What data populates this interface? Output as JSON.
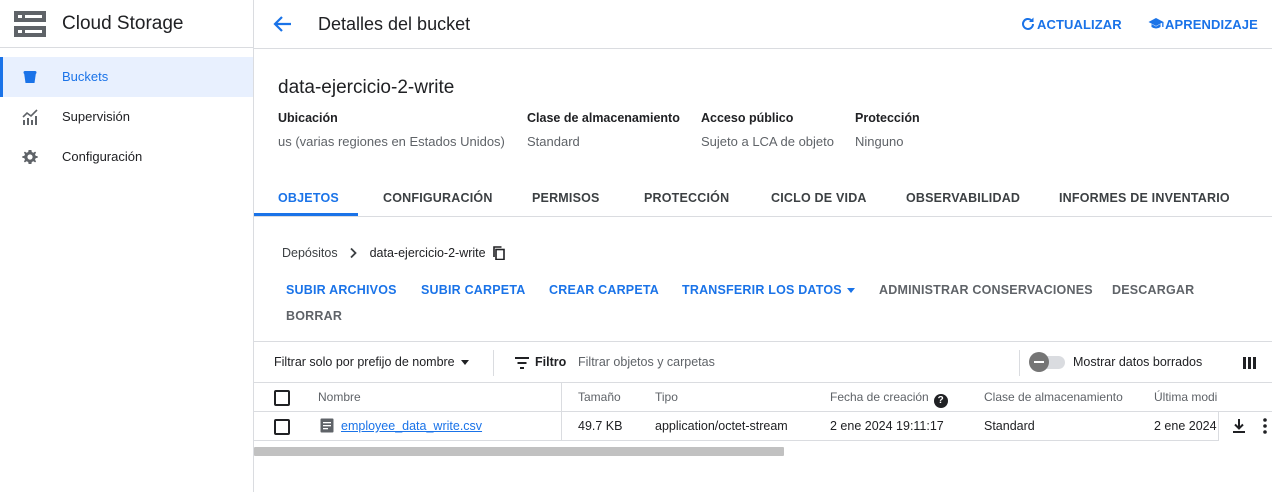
{
  "sidebar": {
    "product_title": "Cloud Storage",
    "items": [
      {
        "label": "Buckets",
        "icon": "bucket-icon",
        "active": true
      },
      {
        "label": "Supervisión",
        "icon": "monitoring-chart-icon",
        "active": false
      },
      {
        "label": "Configuración",
        "icon": "gear-icon",
        "active": false
      }
    ]
  },
  "header": {
    "title": "Detalles del bucket",
    "refresh_label": "ACTUALIZAR",
    "learn_label": "APRENDIZAJE"
  },
  "bucket": {
    "name": "data-ejercicio-2-write",
    "info": [
      {
        "label": "Ubicación",
        "value": "us (varias regiones en Estados Unidos)"
      },
      {
        "label": "Clase de almacenamiento",
        "value": "Standard"
      },
      {
        "label": "Acceso público",
        "value": "Sujeto a LCA de objeto"
      },
      {
        "label": "Protección",
        "value": "Ninguno"
      }
    ]
  },
  "tabs": [
    {
      "label": "OBJETOS",
      "active": true
    },
    {
      "label": "CONFIGURACIÓN",
      "active": false
    },
    {
      "label": "PERMISOS",
      "active": false
    },
    {
      "label": "PROTECCIÓN",
      "active": false
    },
    {
      "label": "CICLO DE VIDA",
      "active": false
    },
    {
      "label": "OBSERVABILIDAD",
      "active": false
    },
    {
      "label": "INFORMES DE INVENTARIO",
      "active": false
    }
  ],
  "breadcrumb": {
    "root": "Depósitos",
    "current": "data-ejercicio-2-write"
  },
  "actions": {
    "upload_files": "SUBIR ARCHIVOS",
    "upload_folder": "SUBIR CARPETA",
    "create_folder": "CREAR CARPETA",
    "transfer_data": "TRANSFERIR LOS DATOS",
    "manage_holds": "ADMINISTRAR CONSERVACIONES",
    "download": "DESCARGAR",
    "delete": "BORRAR"
  },
  "filter": {
    "prefix_select": "Filtrar solo por prefijo de nombre",
    "filter_label": "Filtro",
    "placeholder": "Filtrar objetos y carpetas",
    "show_deleted_label": "Mostrar datos borrados",
    "show_deleted_on": false
  },
  "table": {
    "columns": [
      "Nombre",
      "Tamaño",
      "Tipo",
      "Fecha de creación",
      "Clase de almacenamiento",
      "Última modi"
    ],
    "rows": [
      {
        "name": "employee_data_write.csv",
        "size": "49.7 KB",
        "type": "application/octet-stream",
        "created": "2 ene 2024 19:11:17",
        "storage_class": "Standard",
        "last_modified": "2 ene 2024"
      }
    ]
  },
  "colors": {
    "accent": "#1a73e8",
    "active_nav_bg": "#e8f0fe",
    "text": "#202124",
    "muted": "#5f6368",
    "border": "#dadce0"
  }
}
